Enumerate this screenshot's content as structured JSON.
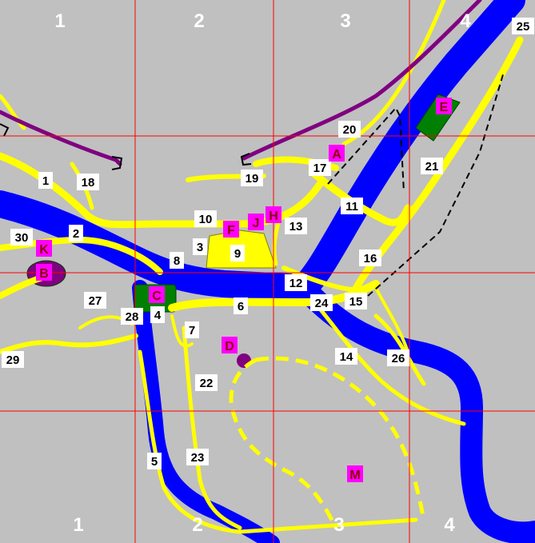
{
  "colors": {
    "background": "#c0c0c0",
    "river": "#0000ff",
    "road": "#ffff00",
    "road_outline": "#808000",
    "grid": "#ff0000",
    "rail": "#800080",
    "trail": "#000000",
    "park": "#008000",
    "poi": "#ff00ff",
    "label_bg": "#ffffff",
    "dashed_path": "#ffff00"
  },
  "grid": {
    "top_labels": [
      "1",
      "2",
      "3",
      "4"
    ],
    "bottom_labels": [
      "1",
      "2",
      "3",
      "4"
    ]
  },
  "labels": [
    {
      "id": "1",
      "text": "1"
    },
    {
      "id": "2",
      "text": "2"
    },
    {
      "id": "3",
      "text": "3"
    },
    {
      "id": "4",
      "text": "4"
    },
    {
      "id": "5",
      "text": "5"
    },
    {
      "id": "6",
      "text": "6"
    },
    {
      "id": "7",
      "text": "7"
    },
    {
      "id": "8",
      "text": "8"
    },
    {
      "id": "9",
      "text": "9"
    },
    {
      "id": "10",
      "text": "10"
    },
    {
      "id": "11",
      "text": "11"
    },
    {
      "id": "12",
      "text": "12"
    },
    {
      "id": "13",
      "text": "13"
    },
    {
      "id": "14",
      "text": "14"
    },
    {
      "id": "15",
      "text": "15"
    },
    {
      "id": "16",
      "text": "16"
    },
    {
      "id": "17",
      "text": "17"
    },
    {
      "id": "18",
      "text": "18"
    },
    {
      "id": "19",
      "text": "19"
    },
    {
      "id": "20",
      "text": "20"
    },
    {
      "id": "21",
      "text": "21"
    },
    {
      "id": "22",
      "text": "22"
    },
    {
      "id": "23",
      "text": "23"
    },
    {
      "id": "24",
      "text": "24"
    },
    {
      "id": "25",
      "text": "25"
    },
    {
      "id": "26",
      "text": "26"
    },
    {
      "id": "27",
      "text": "27"
    },
    {
      "id": "28",
      "text": "28"
    },
    {
      "id": "29",
      "text": "29"
    },
    {
      "id": "30",
      "text": "30"
    }
  ],
  "pois": [
    {
      "id": "A",
      "text": "A"
    },
    {
      "id": "B",
      "text": "B"
    },
    {
      "id": "C",
      "text": "C"
    },
    {
      "id": "D",
      "text": "D"
    },
    {
      "id": "E",
      "text": "E"
    },
    {
      "id": "F",
      "text": "F"
    },
    {
      "id": "H",
      "text": "H"
    },
    {
      "id": "J",
      "text": "J"
    },
    {
      "id": "K",
      "text": "K"
    },
    {
      "id": "M",
      "text": "M"
    }
  ]
}
